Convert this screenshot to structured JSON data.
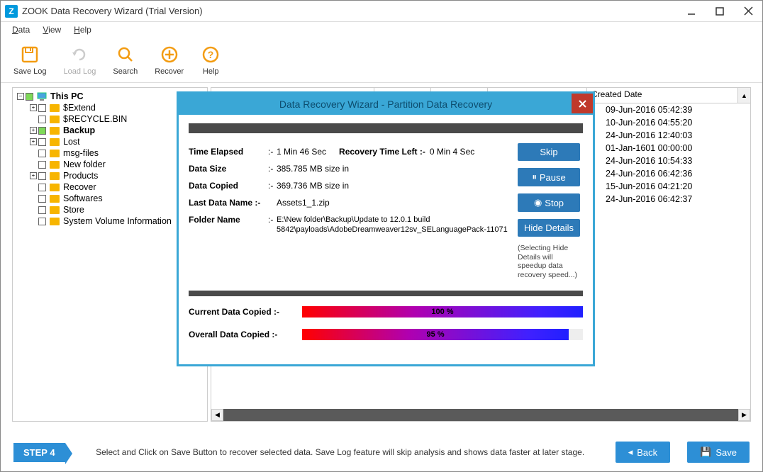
{
  "window": {
    "app_icon_letter": "Z",
    "title": "ZOOK Data Recovery Wizard (Trial Version)"
  },
  "menu": {
    "items": [
      "Data",
      "View",
      "Help"
    ]
  },
  "toolbar": {
    "save_log": "Save Log",
    "load_log": "Load Log",
    "search": "Search",
    "recover": "Recover",
    "help": "Help"
  },
  "tree": {
    "root": "This PC",
    "items": [
      {
        "name": "$Extend",
        "expandable": true,
        "checked": false,
        "depth": 1
      },
      {
        "name": "$RECYCLE.BIN",
        "expandable": false,
        "checked": false,
        "depth": 1
      },
      {
        "name": "Backup",
        "expandable": true,
        "checked": true,
        "depth": 1,
        "bold": true
      },
      {
        "name": "Lost",
        "expandable": true,
        "checked": false,
        "depth": 1
      },
      {
        "name": "msg-files",
        "expandable": false,
        "checked": false,
        "depth": 1
      },
      {
        "name": "New folder",
        "expandable": false,
        "checked": false,
        "depth": 1
      },
      {
        "name": "Products",
        "expandable": true,
        "checked": false,
        "depth": 1
      },
      {
        "name": "Recover",
        "expandable": false,
        "checked": false,
        "depth": 1
      },
      {
        "name": "Softwares",
        "expandable": false,
        "checked": false,
        "depth": 1
      },
      {
        "name": "Store",
        "expandable": false,
        "checked": false,
        "depth": 1
      },
      {
        "name": "System Volume Information",
        "expandable": false,
        "checked": false,
        "depth": 1
      }
    ]
  },
  "list": {
    "col_created": "Created Date",
    "dates": [
      "09-Jun-2016 05:42:39",
      "10-Jun-2016 04:55:20",
      "24-Jun-2016 12:40:03",
      "01-Jan-1601 00:00:00",
      "24-Jun-2016 10:54:33",
      "24-Jun-2016 06:42:36",
      "15-Jun-2016 04:21:20",
      "24-Jun-2016 06:42:37"
    ]
  },
  "dialog": {
    "title": "Data Recovery Wizard - Partition Data Recovery",
    "labels": {
      "time_elapsed": "Time Elapsed",
      "recovery_time_left": "Recovery Time Left  :-",
      "data_size": "Data Size",
      "data_copied": "Data Copied",
      "last_data_name": "Last Data Name :-",
      "folder_name": "Folder Name",
      "current_copied": "Current Data Copied :-",
      "overall_copied": "Overall Data Copied :-"
    },
    "values": {
      "time_elapsed": "1 Min 46 Sec",
      "recovery_time_left": "0 Min 4 Sec",
      "data_size": "385.785 MB size in",
      "data_copied": "369.736 MB size in",
      "last_data_name": "Assets1_1.zip",
      "folder_name": "E:\\New folder\\Backup\\Update to 12.0.1 build 5842\\payloads\\AdobeDreamweaver12sv_SELanguagePack-11071",
      "current_pct": "100 %",
      "overall_pct": "95 %"
    },
    "buttons": {
      "skip": "Skip",
      "pause": "Pause",
      "stop": "Stop",
      "hide_details": "Hide Details"
    },
    "note": "(Selecting Hide Details will speedup data recovery speed...)"
  },
  "footer": {
    "step": "STEP 4",
    "hint": "Select and Click on Save Button to recover selected data. Save Log feature will skip analysis and shows data faster at later stage.",
    "back": "Back",
    "save": "Save"
  }
}
